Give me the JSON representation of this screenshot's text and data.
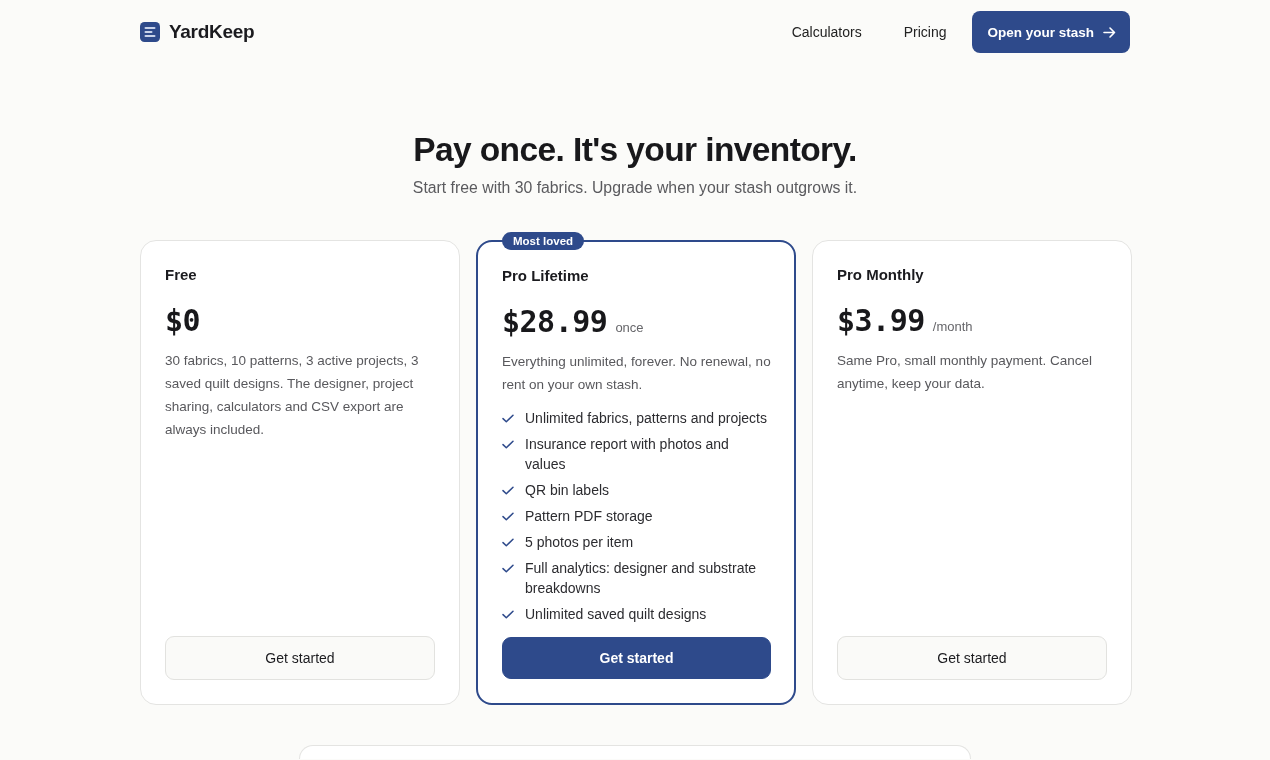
{
  "header": {
    "logo": "YardKeep",
    "nav": [
      "Calculators",
      "Pricing"
    ],
    "cta": "Open your stash"
  },
  "hero": {
    "title": "Pay once. It's your inventory.",
    "subtitle": "Start free with 30 fabrics. Upgrade when your stash outgrows it."
  },
  "plans": [
    {
      "name": "Free",
      "price": "$0",
      "description": "30 fabrics, 10 patterns, 3 active projects, 3 saved quilt designs. The designer, project sharing, calculators and CSV export are always included.",
      "button": "Get started",
      "featured": false
    },
    {
      "name": "Pro Lifetime",
      "badge": "Most loved",
      "price": "$28.99",
      "period": "once",
      "description": "Everything unlimited, forever. No renewal, no rent on your own stash.",
      "features": [
        "Unlimited fabrics, patterns and projects",
        "Insurance report with photos and values",
        "QR bin labels",
        "Pattern PDF storage",
        "5 photos per item",
        "Full analytics: designer and substrate breakdowns",
        "Unlimited saved quilt designs"
      ],
      "button": "Get started",
      "featured": true
    },
    {
      "name": "Pro Monthly",
      "price": "$3.99",
      "period": "/month",
      "description": "Same Pro, small monthly payment. Cancel anytime, keep your data.",
      "button": "Get started",
      "featured": false
    }
  ]
}
